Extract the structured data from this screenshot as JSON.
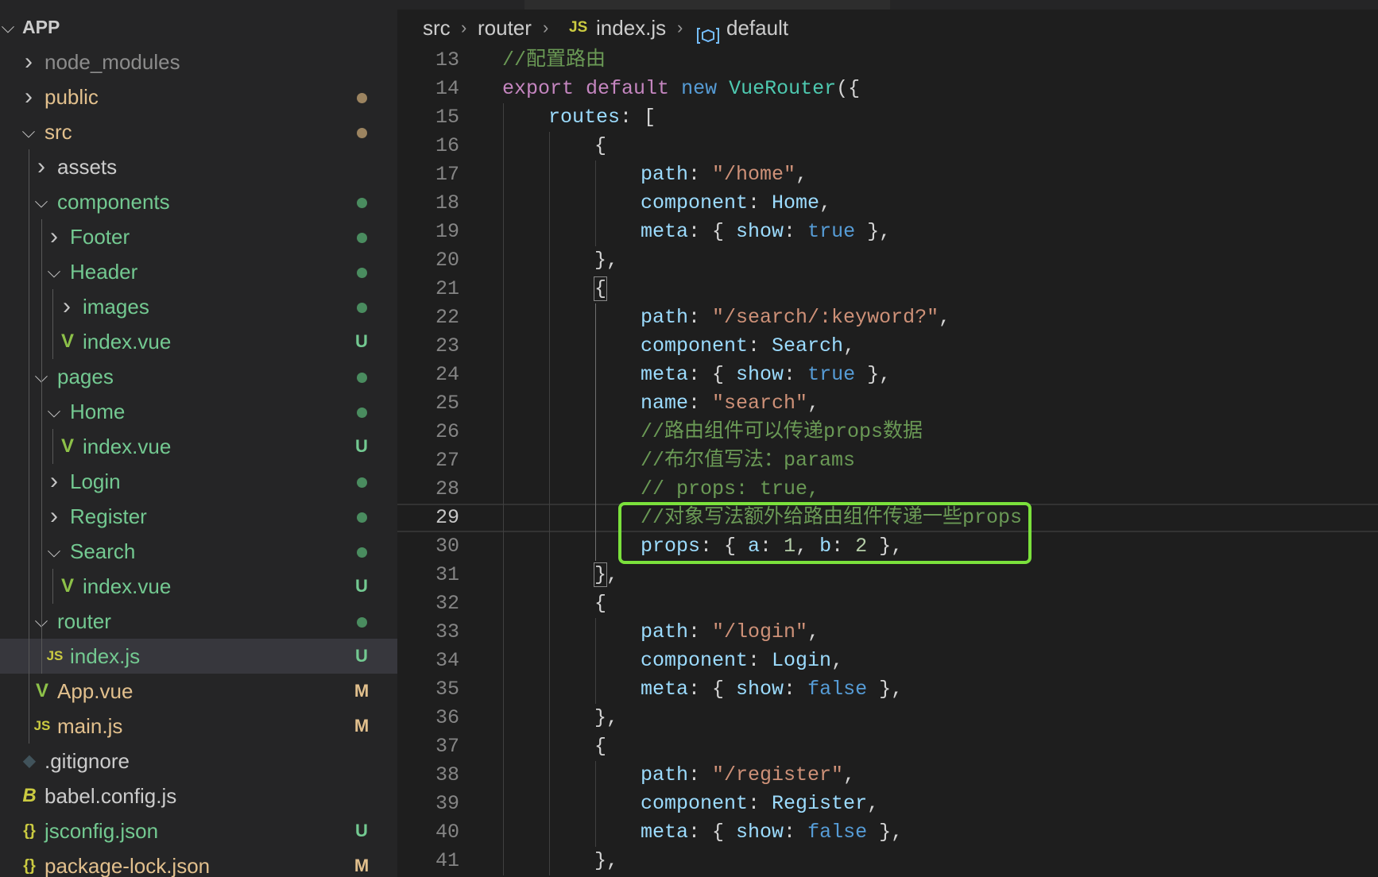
{
  "colors": {
    "folder_modified": "#e2c08d",
    "folder_green": "#73c991",
    "text_default": "#cccccc",
    "text_muted": "#8c8c8c",
    "badge_untracked": "#73c991",
    "badge_modified": "#e2c08d",
    "vue_icon": "#8dc149",
    "js_icon": "#cbcb41",
    "highlight_box": "#7be13c",
    "tok_keyword_purple": "#c586c0",
    "tok_keyword_blue": "#569cd6",
    "tok_class": "#4ec9b0",
    "tok_property": "#9cdcfe",
    "tok_string": "#ce9178",
    "tok_number": "#b5cea8",
    "tok_comment": "#6a9955",
    "tok_punct": "#d4d4d4"
  },
  "explorer": {
    "root_label": "APP",
    "items": [
      {
        "label": "node_modules",
        "depth": 0,
        "kind": "folder",
        "expanded": false,
        "color": "text_muted",
        "icon": "",
        "status": ""
      },
      {
        "label": "public",
        "depth": 0,
        "kind": "folder",
        "expanded": false,
        "color": "folder_modified",
        "icon": "",
        "status": "dot-modified"
      },
      {
        "label": "src",
        "depth": 0,
        "kind": "folder",
        "expanded": true,
        "color": "folder_modified",
        "icon": "",
        "status": "dot-modified"
      },
      {
        "label": "assets",
        "depth": 1,
        "kind": "folder",
        "expanded": false,
        "color": "text_default",
        "icon": "",
        "status": ""
      },
      {
        "label": "components",
        "depth": 1,
        "kind": "folder",
        "expanded": true,
        "color": "folder_green",
        "icon": "",
        "status": "dot-green"
      },
      {
        "label": "Footer",
        "depth": 2,
        "kind": "folder",
        "expanded": false,
        "color": "folder_green",
        "icon": "",
        "status": "dot-green"
      },
      {
        "label": "Header",
        "depth": 2,
        "kind": "folder",
        "expanded": true,
        "color": "folder_green",
        "icon": "",
        "status": "dot-green"
      },
      {
        "label": "images",
        "depth": 3,
        "kind": "folder",
        "expanded": false,
        "color": "folder_green",
        "icon": "",
        "status": "dot-green"
      },
      {
        "label": "index.vue",
        "depth": 3,
        "kind": "file",
        "color": "folder_green",
        "icon": "vue",
        "status": "U"
      },
      {
        "label": "pages",
        "depth": 1,
        "kind": "folder",
        "expanded": true,
        "color": "folder_green",
        "icon": "",
        "status": "dot-green"
      },
      {
        "label": "Home",
        "depth": 2,
        "kind": "folder",
        "expanded": true,
        "color": "folder_green",
        "icon": "",
        "status": "dot-green"
      },
      {
        "label": "index.vue",
        "depth": 3,
        "kind": "file",
        "color": "folder_green",
        "icon": "vue",
        "status": "U"
      },
      {
        "label": "Login",
        "depth": 2,
        "kind": "folder",
        "expanded": false,
        "color": "folder_green",
        "icon": "",
        "status": "dot-green"
      },
      {
        "label": "Register",
        "depth": 2,
        "kind": "folder",
        "expanded": false,
        "color": "folder_green",
        "icon": "",
        "status": "dot-green"
      },
      {
        "label": "Search",
        "depth": 2,
        "kind": "folder",
        "expanded": true,
        "color": "folder_green",
        "icon": "",
        "status": "dot-green"
      },
      {
        "label": "index.vue",
        "depth": 3,
        "kind": "file",
        "color": "folder_green",
        "icon": "vue",
        "status": "U"
      },
      {
        "label": "router",
        "depth": 1,
        "kind": "folder",
        "expanded": true,
        "color": "folder_green",
        "icon": "",
        "status": "dot-green"
      },
      {
        "label": "index.js",
        "depth": 2,
        "kind": "file",
        "color": "folder_green",
        "icon": "js",
        "status": "U",
        "selected": true
      },
      {
        "label": "App.vue",
        "depth": 1,
        "kind": "file",
        "color": "folder_modified",
        "icon": "vue",
        "status": "M"
      },
      {
        "label": "main.js",
        "depth": 1,
        "kind": "file",
        "color": "folder_modified",
        "icon": "js",
        "status": "M"
      },
      {
        "label": ".gitignore",
        "depth": 0,
        "kind": "file",
        "color": "text_default",
        "icon": "git",
        "status": ""
      },
      {
        "label": "babel.config.js",
        "depth": 0,
        "kind": "file",
        "color": "text_default",
        "icon": "babel",
        "status": ""
      },
      {
        "label": "jsconfig.json",
        "depth": 0,
        "kind": "file",
        "color": "folder_green",
        "icon": "json",
        "status": "U"
      },
      {
        "label": "package-lock.json",
        "depth": 0,
        "kind": "file",
        "color": "folder_modified",
        "icon": "json",
        "status": "M"
      }
    ]
  },
  "breadcrumb": {
    "parts": [
      "src",
      "router",
      "index.js",
      "default"
    ],
    "js_badge": "JS"
  },
  "editor": {
    "current_line": 29,
    "highlight_box": {
      "from_line": 29,
      "to_line": 30
    },
    "lines": [
      {
        "n": "13",
        "indent": 0,
        "tokens": [
          [
            "//配置路由",
            "tok_comment"
          ]
        ]
      },
      {
        "n": "14",
        "indent": 0,
        "tokens": [
          [
            "export",
            "tok_keyword_purple"
          ],
          [
            " ",
            "tok_punct"
          ],
          [
            "default",
            "tok_keyword_purple"
          ],
          [
            " ",
            "tok_punct"
          ],
          [
            "new",
            "tok_keyword_blue"
          ],
          [
            " ",
            "tok_punct"
          ],
          [
            "VueRouter",
            "tok_class"
          ],
          [
            "({",
            "tok_punct"
          ]
        ]
      },
      {
        "n": "15",
        "indent": 1,
        "tokens": [
          [
            "routes",
            "tok_property"
          ],
          [
            ": [",
            "tok_punct"
          ]
        ]
      },
      {
        "n": "16",
        "indent": 2,
        "tokens": [
          [
            "{",
            "tok_punct"
          ]
        ]
      },
      {
        "n": "17",
        "indent": 3,
        "tokens": [
          [
            "path",
            "tok_property"
          ],
          [
            ": ",
            "tok_punct"
          ],
          [
            "\"/home\"",
            "tok_string"
          ],
          [
            ",",
            "tok_punct"
          ]
        ]
      },
      {
        "n": "18",
        "indent": 3,
        "tokens": [
          [
            "component",
            "tok_property"
          ],
          [
            ": ",
            "tok_punct"
          ],
          [
            "Home",
            "tok_property"
          ],
          [
            ",",
            "tok_punct"
          ]
        ]
      },
      {
        "n": "19",
        "indent": 3,
        "tokens": [
          [
            "meta",
            "tok_property"
          ],
          [
            ": { ",
            "tok_punct"
          ],
          [
            "show",
            "tok_property"
          ],
          [
            ": ",
            "tok_punct"
          ],
          [
            "true",
            "tok_keyword_blue"
          ],
          [
            " },",
            "tok_punct"
          ]
        ]
      },
      {
        "n": "20",
        "indent": 2,
        "tokens": [
          [
            "},",
            "tok_punct"
          ]
        ]
      },
      {
        "n": "21",
        "indent": 2,
        "tokens": [
          [
            "{",
            "tok_punct"
          ]
        ],
        "bracket_match": true
      },
      {
        "n": "22",
        "indent": 3,
        "tokens": [
          [
            "path",
            "tok_property"
          ],
          [
            ": ",
            "tok_punct"
          ],
          [
            "\"/search/:keyword?\"",
            "tok_string"
          ],
          [
            ",",
            "tok_punct"
          ]
        ]
      },
      {
        "n": "23",
        "indent": 3,
        "tokens": [
          [
            "component",
            "tok_property"
          ],
          [
            ": ",
            "tok_punct"
          ],
          [
            "Search",
            "tok_property"
          ],
          [
            ",",
            "tok_punct"
          ]
        ]
      },
      {
        "n": "24",
        "indent": 3,
        "tokens": [
          [
            "meta",
            "tok_property"
          ],
          [
            ": { ",
            "tok_punct"
          ],
          [
            "show",
            "tok_property"
          ],
          [
            ": ",
            "tok_punct"
          ],
          [
            "true",
            "tok_keyword_blue"
          ],
          [
            " },",
            "tok_punct"
          ]
        ]
      },
      {
        "n": "25",
        "indent": 3,
        "tokens": [
          [
            "name",
            "tok_property"
          ],
          [
            ": ",
            "tok_punct"
          ],
          [
            "\"search\"",
            "tok_string"
          ],
          [
            ",",
            "tok_punct"
          ]
        ]
      },
      {
        "n": "26",
        "indent": 3,
        "tokens": [
          [
            "//路由组件可以传递props数据",
            "tok_comment"
          ]
        ]
      },
      {
        "n": "27",
        "indent": 3,
        "tokens": [
          [
            "//布尔值写法：params",
            "tok_comment"
          ]
        ]
      },
      {
        "n": "28",
        "indent": 3,
        "tokens": [
          [
            "// props: true,",
            "tok_comment"
          ]
        ]
      },
      {
        "n": "29",
        "indent": 3,
        "tokens": [
          [
            "//对象写法额外给路由组件传递一些props",
            "tok_comment"
          ]
        ]
      },
      {
        "n": "30",
        "indent": 3,
        "tokens": [
          [
            "props",
            "tok_property"
          ],
          [
            ": { ",
            "tok_punct"
          ],
          [
            "a",
            "tok_property"
          ],
          [
            ": ",
            "tok_punct"
          ],
          [
            "1",
            "tok_number"
          ],
          [
            ", ",
            "tok_punct"
          ],
          [
            "b",
            "tok_property"
          ],
          [
            ": ",
            "tok_punct"
          ],
          [
            "2",
            "tok_number"
          ],
          [
            " },",
            "tok_punct"
          ]
        ]
      },
      {
        "n": "31",
        "indent": 2,
        "tokens": [
          [
            "}",
            "tok_punct"
          ],
          [
            ",",
            "tok_punct"
          ]
        ],
        "bracket_match": true
      },
      {
        "n": "32",
        "indent": 2,
        "tokens": [
          [
            "{",
            "tok_punct"
          ]
        ]
      },
      {
        "n": "33",
        "indent": 3,
        "tokens": [
          [
            "path",
            "tok_property"
          ],
          [
            ": ",
            "tok_punct"
          ],
          [
            "\"/login\"",
            "tok_string"
          ],
          [
            ",",
            "tok_punct"
          ]
        ]
      },
      {
        "n": "34",
        "indent": 3,
        "tokens": [
          [
            "component",
            "tok_property"
          ],
          [
            ": ",
            "tok_punct"
          ],
          [
            "Login",
            "tok_property"
          ],
          [
            ",",
            "tok_punct"
          ]
        ]
      },
      {
        "n": "35",
        "indent": 3,
        "tokens": [
          [
            "meta",
            "tok_property"
          ],
          [
            ": { ",
            "tok_punct"
          ],
          [
            "show",
            "tok_property"
          ],
          [
            ": ",
            "tok_punct"
          ],
          [
            "false",
            "tok_keyword_blue"
          ],
          [
            " },",
            "tok_punct"
          ]
        ]
      },
      {
        "n": "36",
        "indent": 2,
        "tokens": [
          [
            "},",
            "tok_punct"
          ]
        ]
      },
      {
        "n": "37",
        "indent": 2,
        "tokens": [
          [
            "{",
            "tok_punct"
          ]
        ]
      },
      {
        "n": "38",
        "indent": 3,
        "tokens": [
          [
            "path",
            "tok_property"
          ],
          [
            ": ",
            "tok_punct"
          ],
          [
            "\"/register\"",
            "tok_string"
          ],
          [
            ",",
            "tok_punct"
          ]
        ]
      },
      {
        "n": "39",
        "indent": 3,
        "tokens": [
          [
            "component",
            "tok_property"
          ],
          [
            ": ",
            "tok_punct"
          ],
          [
            "Register",
            "tok_property"
          ],
          [
            ",",
            "tok_punct"
          ]
        ]
      },
      {
        "n": "40",
        "indent": 3,
        "tokens": [
          [
            "meta",
            "tok_property"
          ],
          [
            ": { ",
            "tok_punct"
          ],
          [
            "show",
            "tok_property"
          ],
          [
            ": ",
            "tok_punct"
          ],
          [
            "false",
            "tok_keyword_blue"
          ],
          [
            " },",
            "tok_punct"
          ]
        ]
      },
      {
        "n": "41",
        "indent": 2,
        "tokens": [
          [
            "},",
            "tok_punct"
          ]
        ]
      }
    ]
  }
}
